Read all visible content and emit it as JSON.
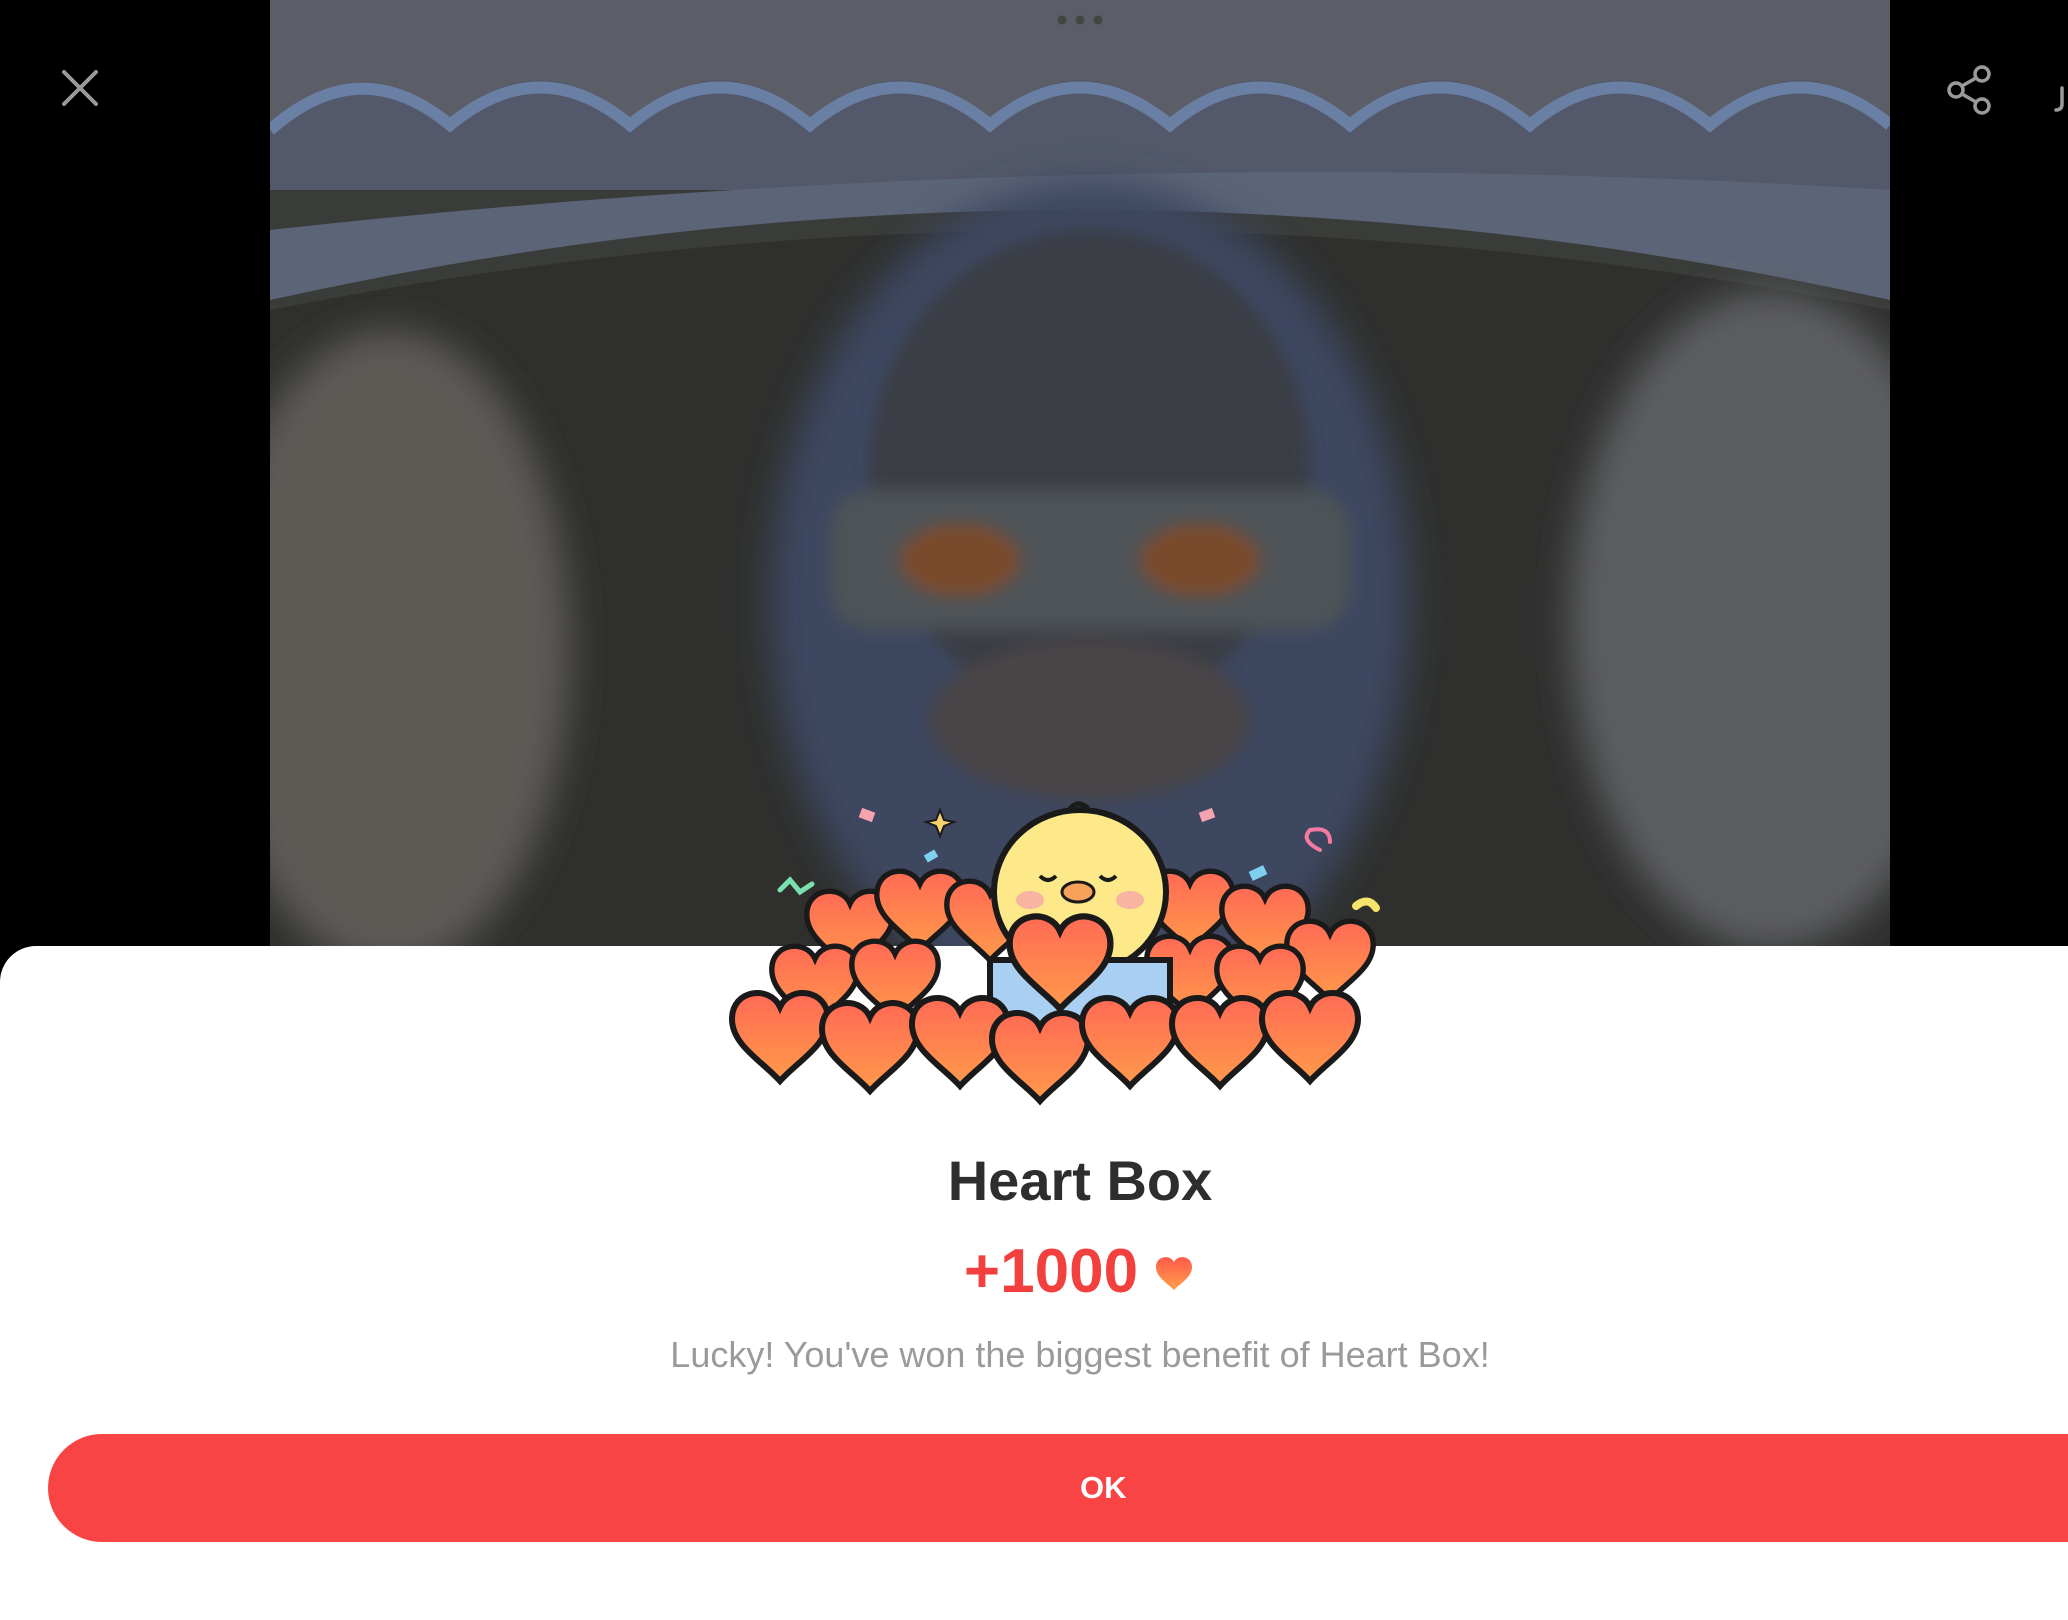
{
  "header": {
    "close_icon": "close-icon",
    "more_icon": "more-dots-icon",
    "share_icon": "share-icon"
  },
  "popup": {
    "title": "Heart Box",
    "reward_amount": "+1000",
    "reward_icon": "heart-icon",
    "message": "Lucky! You've won the biggest benefit of Heart Box!",
    "ok_label": "OK"
  },
  "colors": {
    "accent": "#f84444",
    "reward_text": "#f2403f",
    "title_text": "#2e2e2e",
    "message_text": "#9a9a9a"
  }
}
